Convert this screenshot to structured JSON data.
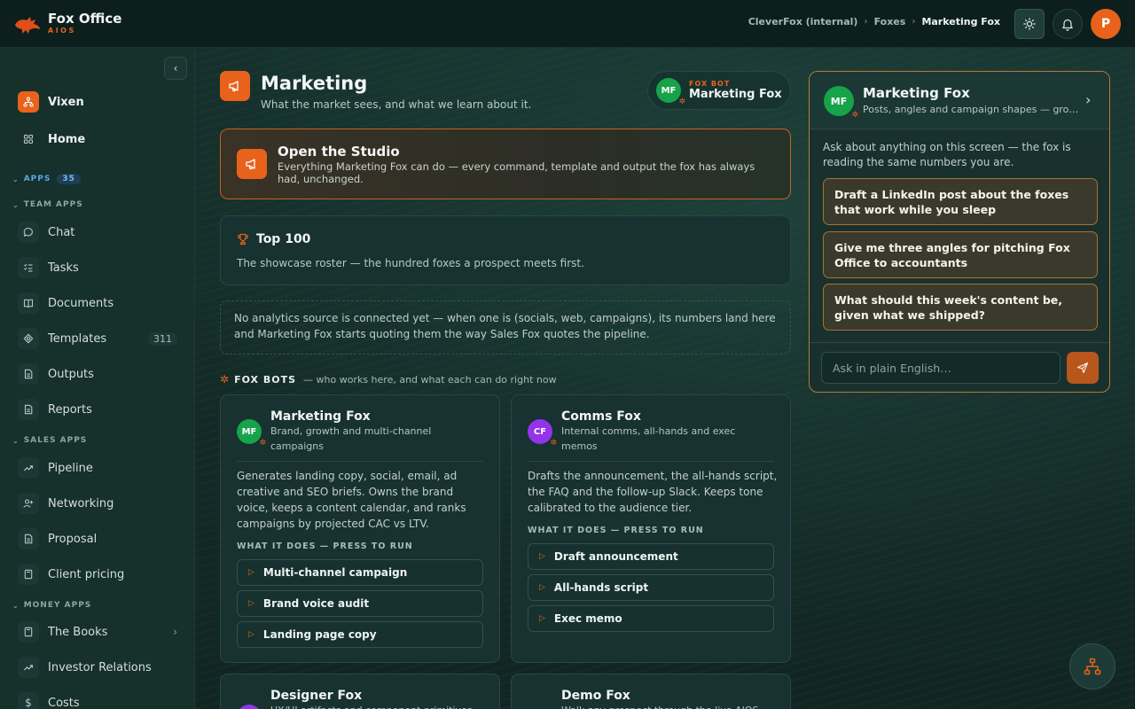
{
  "app": {
    "name": "Fox Office",
    "sub": "AIOS"
  },
  "breadcrumb": [
    "CleverFox (internal)",
    "Foxes",
    "Marketing Fox"
  ],
  "user": {
    "initial": "P"
  },
  "sidebar": {
    "workspace": "Vixen",
    "home": "Home",
    "apps_label": "APPS",
    "apps_count": "35",
    "team_label": "TEAM APPS",
    "team": [
      {
        "label": "Chat",
        "icon": "chat-icon"
      },
      {
        "label": "Tasks",
        "icon": "checklist-icon"
      },
      {
        "label": "Documents",
        "icon": "book-icon"
      },
      {
        "label": "Templates",
        "icon": "template-icon",
        "count": "311"
      },
      {
        "label": "Outputs",
        "icon": "file-icon"
      },
      {
        "label": "Reports",
        "icon": "file-icon"
      }
    ],
    "sales_label": "SALES APPS",
    "sales": [
      {
        "label": "Pipeline",
        "icon": "trend-icon"
      },
      {
        "label": "Networking",
        "icon": "user-plus-icon"
      },
      {
        "label": "Proposal",
        "icon": "file-icon"
      },
      {
        "label": "Client pricing",
        "icon": "calculator-icon"
      }
    ],
    "money_label": "MONEY APPS",
    "money": [
      {
        "label": "The Books",
        "icon": "calculator-icon"
      },
      {
        "label": "Investor Relations",
        "icon": "trend-icon"
      },
      {
        "label": "Costs",
        "icon": "dollar-icon"
      }
    ]
  },
  "page": {
    "title": "Marketing",
    "subtitle": "What the market sees, and what we learn about it.",
    "bot_kicker": "FOX BOT",
    "bot_name": "Marketing Fox",
    "bot_initials": "MF"
  },
  "studio": {
    "title": "Open the Studio",
    "desc": "Everything Marketing Fox can do — every command, template and output the fox has always had, unchanged."
  },
  "top100": {
    "title": "Top 100",
    "desc": "The showcase roster — the hundred foxes a prospect meets first."
  },
  "notice": "No analytics source is connected yet — when one is (socials, web, campaigns), its numbers land here and Marketing Fox starts quoting them the way Sales Fox quotes the pipeline.",
  "fox_bots": {
    "title": "FOX BOTS",
    "sub": "— who works here, and what each can do right now",
    "cards": [
      {
        "initials": "MF",
        "color": "#16a34a",
        "name": "Marketing Fox",
        "role": "Brand, growth and multi-channel campaigns",
        "desc": "Generates landing copy, social, email, ad creative and SEO briefs. Owns the brand voice, keeps a content calendar, and ranks campaigns by projected CAC vs LTV.",
        "actions_label": "WHAT IT DOES — PRESS TO RUN",
        "actions": [
          "Multi-channel campaign",
          "Brand voice audit",
          "Landing page copy"
        ]
      },
      {
        "initials": "CF",
        "color": "#9333ea",
        "name": "Comms Fox",
        "role": "Internal comms, all-hands and exec memos",
        "desc": "Drafts the announcement, the all-hands script, the FAQ and the follow-up Slack. Keeps tone calibrated to the audience tier.",
        "actions_label": "WHAT IT DOES — PRESS TO RUN",
        "actions": [
          "Draft announcement",
          "All-hands script",
          "Exec memo"
        ]
      },
      {
        "initials": "DF",
        "color": "#9333ea",
        "name": "Designer Fox",
        "role": "UX/UI artifacts and component primitives"
      },
      {
        "initials": "DF",
        "color": "#0369a1",
        "name": "Demo Fox",
        "role": "Walk any prospect through the live AIOS"
      }
    ]
  },
  "chat": {
    "name": "Marketing Fox",
    "desc": "Posts, angles and campaign shapes — grounded in what we shipped",
    "intro": "Ask about anything on this screen — the fox is reading the same numbers you are.",
    "suggestions": [
      "Draft a LinkedIn post about the foxes that work while you sleep",
      "Give me three angles for pitching Fox Office to accountants",
      "What should this week's content be, given what we shipped?"
    ],
    "placeholder": "Ask in plain English…"
  },
  "colors": {
    "accent": "#e8621c",
    "gold_border": "#b57a35"
  }
}
